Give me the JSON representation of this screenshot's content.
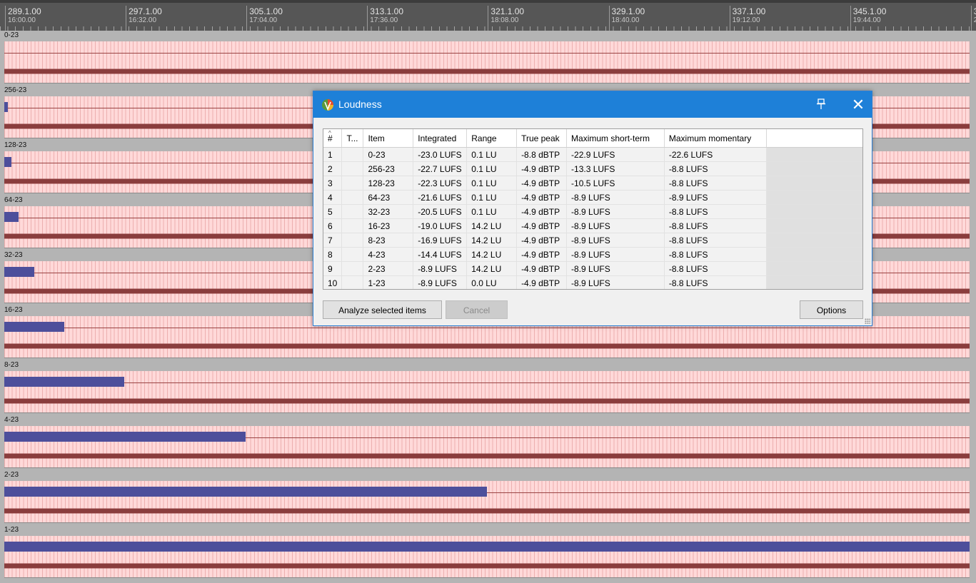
{
  "ruler": {
    "marks": [
      {
        "main": "289.1.00",
        "sub": "16:00.00"
      },
      {
        "main": "297.1.00",
        "sub": "16:32.00"
      },
      {
        "main": "305.1.00",
        "sub": "17:04.00"
      },
      {
        "main": "313.1.00",
        "sub": "17:36.00"
      },
      {
        "main": "321.1.00",
        "sub": "18:08.00"
      },
      {
        "main": "329.1.00",
        "sub": "18:40.00"
      },
      {
        "main": "337.1.00",
        "sub": "19:12.00"
      },
      {
        "main": "345.1.00",
        "sub": "19:44.00"
      },
      {
        "main": "3",
        "sub": "2"
      }
    ]
  },
  "tracks": [
    {
      "name": "0-23",
      "item_extent": 0
    },
    {
      "name": "256-23",
      "item_extent": 0.0037
    },
    {
      "name": "128-23",
      "item_extent": 0.0074
    },
    {
      "name": "64-23",
      "item_extent": 0.0148
    },
    {
      "name": "32-23",
      "item_extent": 0.031
    },
    {
      "name": "16-23",
      "item_extent": 0.062
    },
    {
      "name": "8-23",
      "item_extent": 0.124
    },
    {
      "name": "4-23",
      "item_extent": 0.25
    },
    {
      "name": "2-23",
      "item_extent": 0.5
    },
    {
      "name": "1-23",
      "item_extent": 1.0
    }
  ],
  "dialog": {
    "title": "Loudness",
    "columns": [
      "#",
      "T...",
      "Item",
      "Integrated",
      "Range",
      "True peak",
      "Maximum short-term",
      "Maximum momentary"
    ],
    "rows": [
      [
        "1",
        "",
        "0-23",
        "-23.0 LUFS",
        "0.1 LU",
        "-8.8 dBTP",
        "-22.9 LUFS",
        "-22.6 LUFS"
      ],
      [
        "2",
        "",
        "256-23",
        "-22.7 LUFS",
        "0.1 LU",
        "-4.9 dBTP",
        "-13.3 LUFS",
        "-8.8 LUFS"
      ],
      [
        "3",
        "",
        "128-23",
        "-22.3 LUFS",
        "0.1 LU",
        "-4.9 dBTP",
        "-10.5 LUFS",
        "-8.8 LUFS"
      ],
      [
        "4",
        "",
        "64-23",
        "-21.6 LUFS",
        "0.1 LU",
        "-4.9 dBTP",
        "-8.9 LUFS",
        "-8.9 LUFS"
      ],
      [
        "5",
        "",
        "32-23",
        "-20.5 LUFS",
        "0.1 LU",
        "-4.9 dBTP",
        "-8.9 LUFS",
        "-8.8 LUFS"
      ],
      [
        "6",
        "",
        "16-23",
        "-19.0 LUFS",
        "14.2 LU",
        "-4.9 dBTP",
        "-8.9 LUFS",
        "-8.8 LUFS"
      ],
      [
        "7",
        "",
        "8-23",
        "-16.9 LUFS",
        "14.2 LU",
        "-4.9 dBTP",
        "-8.9 LUFS",
        "-8.8 LUFS"
      ],
      [
        "8",
        "",
        "4-23",
        "-14.4 LUFS",
        "14.2 LU",
        "-4.9 dBTP",
        "-8.9 LUFS",
        "-8.8 LUFS"
      ],
      [
        "9",
        "",
        "2-23",
        "-8.9 LUFS",
        "14.2 LU",
        "-4.9 dBTP",
        "-8.9 LUFS",
        "-8.8 LUFS"
      ],
      [
        "10",
        "",
        "1-23",
        "-8.9 LUFS",
        "0.0 LU",
        "-4.9 dBTP",
        "-8.9 LUFS",
        "-8.8 LUFS"
      ]
    ],
    "buttons": {
      "analyze": "Analyze selected items",
      "cancel": "Cancel",
      "options": "Options"
    },
    "icons": {
      "app": "reaper-logo-icon",
      "pin": "pin-icon",
      "close": "close-icon"
    },
    "colors": {
      "titlebar": "#1e80d8",
      "item_bar": "#4d4f9b",
      "lane": "#ffd9d9",
      "waveform": "#8a3d3d"
    }
  }
}
